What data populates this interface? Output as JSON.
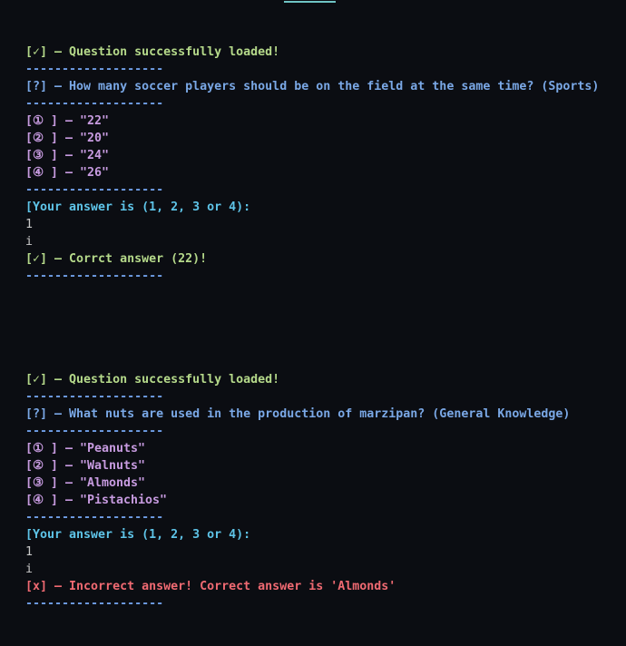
{
  "colors": {
    "background": "#0b0d12",
    "success": "#b5d98a",
    "question": "#7aa8e6",
    "separator": "#6f9ee6",
    "option": "#c79be0",
    "prompt": "#5ec4e8",
    "input": "#c8c8c8",
    "error": "#f06a72",
    "top_indicator": "#6fc4c4"
  },
  "separator": "-------------------",
  "rounds": [
    {
      "loaded": "[✓] – Question successfully loaded!",
      "question": "[?] – How many soccer players should be on the field at the same time? (Sports)",
      "options": [
        "[① ] – \"22\"",
        "[② ] – \"20\"",
        "[③ ] – \"24\"",
        "[④ ] – \"26\""
      ],
      "prompt": "[Your answer is (1, 2, 3 or 4):",
      "inputs": [
        "1",
        "i"
      ],
      "result": "[✓] – Corrct answer (22)!",
      "result_status": "correct"
    },
    {
      "loaded": "[✓] – Question successfully loaded!",
      "question": "[?] – What nuts are used in the production of marzipan? (General Knowledge)",
      "options": [
        "[① ] – \"Peanuts\"",
        "[② ] – \"Walnuts\"",
        "[③ ] – \"Almonds\"",
        "[④ ] – \"Pistachios\""
      ],
      "prompt": "[Your answer is (1, 2, 3 or 4):",
      "inputs": [
        "1",
        "i"
      ],
      "result": "[x] – Incorrect answer! Correct answer is 'Almonds'",
      "result_status": "incorrect"
    }
  ]
}
